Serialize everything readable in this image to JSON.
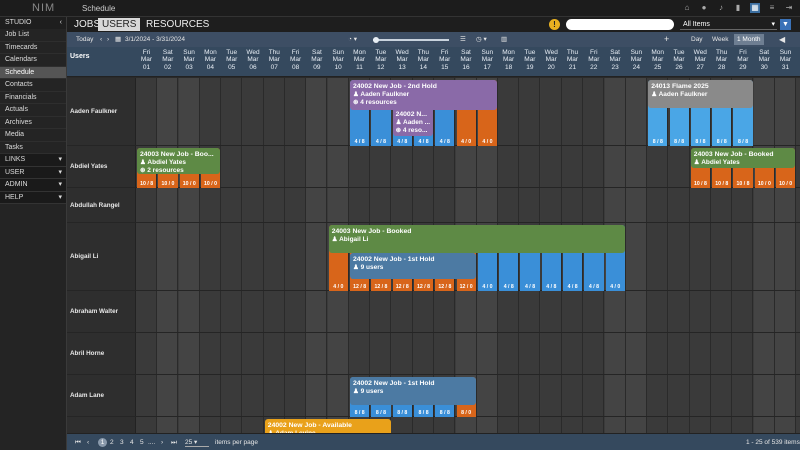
{
  "app": {
    "logo": "NIM",
    "title": "Schedule"
  },
  "top_icons": [
    "home-icon",
    "user-icon",
    "bell-icon",
    "bookmark-icon",
    "apps-icon",
    "sliders-icon",
    "logout-icon"
  ],
  "sidebar": {
    "header": "STUDIO",
    "items": [
      "Job List",
      "Timecards",
      "Calendars",
      "Schedule",
      "Contacts",
      "Financials",
      "Actuals",
      "Archives",
      "Media",
      "Tasks"
    ],
    "active": "Schedule",
    "groups": [
      "LINKS",
      "USER",
      "ADMIN",
      "HELP"
    ]
  },
  "tabs": [
    "JOBS",
    "USERS",
    "RESOURCES"
  ],
  "tabs_selected": "USERS",
  "search": {
    "placeholder": ""
  },
  "filter": {
    "value": "All Items"
  },
  "toolbar": {
    "today": "Today",
    "date_range": "3/1/2024 - 3/31/2024",
    "views": [
      "Day",
      "Week",
      "1 Month"
    ],
    "view_selected": "1 Month",
    "add": "+"
  },
  "columns_header": "Users",
  "days": [
    {
      "dow": "Fri",
      "mon": "Mar",
      "d": "01",
      "we": false
    },
    {
      "dow": "Sat",
      "mon": "Mar",
      "d": "02",
      "we": true
    },
    {
      "dow": "Sun",
      "mon": "Mar",
      "d": "03",
      "we": true
    },
    {
      "dow": "Mon",
      "mon": "Mar",
      "d": "04",
      "we": false
    },
    {
      "dow": "Tue",
      "mon": "Mar",
      "d": "05",
      "we": false
    },
    {
      "dow": "Wed",
      "mon": "Mar",
      "d": "06",
      "we": false
    },
    {
      "dow": "Thu",
      "mon": "Mar",
      "d": "07",
      "we": false
    },
    {
      "dow": "Fri",
      "mon": "Mar",
      "d": "08",
      "we": false
    },
    {
      "dow": "Sat",
      "mon": "Mar",
      "d": "09",
      "we": true
    },
    {
      "dow": "Sun",
      "mon": "Mar",
      "d": "10",
      "we": true
    },
    {
      "dow": "Mon",
      "mon": "Mar",
      "d": "11",
      "we": false
    },
    {
      "dow": "Tue",
      "mon": "Mar",
      "d": "12",
      "we": false
    },
    {
      "dow": "Wed",
      "mon": "Mar",
      "d": "13",
      "we": false
    },
    {
      "dow": "Thu",
      "mon": "Mar",
      "d": "14",
      "we": false
    },
    {
      "dow": "Fri",
      "mon": "Mar",
      "d": "15",
      "we": false
    },
    {
      "dow": "Sat",
      "mon": "Mar",
      "d": "16",
      "we": true
    },
    {
      "dow": "Sun",
      "mon": "Mar",
      "d": "17",
      "we": true
    },
    {
      "dow": "Mon",
      "mon": "Mar",
      "d": "18",
      "we": false
    },
    {
      "dow": "Tue",
      "mon": "Mar",
      "d": "19",
      "we": false
    },
    {
      "dow": "Wed",
      "mon": "Mar",
      "d": "20",
      "we": false
    },
    {
      "dow": "Thu",
      "mon": "Mar",
      "d": "21",
      "we": false
    },
    {
      "dow": "Fri",
      "mon": "Mar",
      "d": "22",
      "we": false
    },
    {
      "dow": "Sat",
      "mon": "Mar",
      "d": "23",
      "we": true
    },
    {
      "dow": "Sun",
      "mon": "Mar",
      "d": "24",
      "we": true
    },
    {
      "dow": "Mon",
      "mon": "Mar",
      "d": "25",
      "we": false
    },
    {
      "dow": "Tue",
      "mon": "Mar",
      "d": "26",
      "we": false
    },
    {
      "dow": "Wed",
      "mon": "Mar",
      "d": "27",
      "we": false
    },
    {
      "dow": "Thu",
      "mon": "Mar",
      "d": "28",
      "we": false
    },
    {
      "dow": "Fri",
      "mon": "Mar",
      "d": "29",
      "we": false
    },
    {
      "dow": "Sat",
      "mon": "Mar",
      "d": "30",
      "we": true
    },
    {
      "dow": "Sun",
      "mon": "Mar",
      "d": "31",
      "we": true
    }
  ],
  "colors": {
    "blue": "#3a8fd8",
    "lightblue": "#4aa6e6",
    "purple": "#8a6aa8",
    "green": "#5e8a45",
    "orange": "#d8651a",
    "amber": "#e9a11a",
    "gray": "#8a8a8a",
    "slate": "#4c7aa3"
  },
  "users": [
    {
      "name": "Aaden Faulkner",
      "bars": [
        {
          "from": 11,
          "to": 15,
          "color": "blue",
          "label": "4 / 8"
        },
        {
          "from": 16,
          "to": 17,
          "color": "orange",
          "label": "4 / 0"
        },
        {
          "from": 25,
          "to": 29,
          "color": "lightblue",
          "label": "8 / 8"
        }
      ],
      "jobs": [
        {
          "from": 11,
          "to": 17,
          "title": "24002 New Job - 2nd Hold",
          "line1": "Aaden Faulkner",
          "line2": "4 resources",
          "color": "purple",
          "y": 2,
          "h": 30
        },
        {
          "from": 13,
          "to": 14,
          "title": "24002 N...",
          "line1": "Aaden ...",
          "line2": "4 reso...",
          "color": "purple",
          "y": 30,
          "h": 28
        },
        {
          "from": 25,
          "to": 29,
          "title": "24013 Flame 2025",
          "line1": "Aaden Faulkner",
          "line2": "",
          "color": "gray",
          "y": 2,
          "h": 28
        }
      ]
    },
    {
      "name": "Abdiel Yates",
      "bars": [
        {
          "from": 1,
          "to": 1,
          "color": "orange",
          "label": "10 / 8"
        },
        {
          "from": 2,
          "to": 4,
          "color": "orange",
          "label": "10 / 0"
        },
        {
          "from": 27,
          "to": 29,
          "color": "orange",
          "label": "10 / 8"
        },
        {
          "from": 30,
          "to": 31,
          "color": "orange",
          "label": "10 / 0"
        }
      ],
      "jobs": [
        {
          "from": 1,
          "to": 4,
          "title": "24003 New Job - Boo...",
          "line1": "Abdiel Yates",
          "line2": "2 resources",
          "color": "green",
          "y": 2,
          "h": 26
        },
        {
          "from": 27,
          "to": 31,
          "title": "24003 New Job - Booked",
          "line1": "Abdiel Yates",
          "line2": "",
          "color": "green",
          "y": 2,
          "h": 20
        }
      ]
    },
    {
      "name": "Abdullah Rangel",
      "bars": [],
      "jobs": []
    },
    {
      "name": "Abigail Li",
      "bars": [
        {
          "from": 10,
          "to": 10,
          "color": "orange",
          "label": "4 / 0"
        },
        {
          "from": 11,
          "to": 15,
          "color": "orange",
          "label": "12 / 8"
        },
        {
          "from": 16,
          "to": 16,
          "color": "orange",
          "label": "12 / 0"
        },
        {
          "from": 17,
          "to": 17,
          "color": "blue",
          "label": "4 / 0"
        },
        {
          "from": 18,
          "to": 22,
          "color": "blue",
          "label": "4 / 8"
        },
        {
          "from": 23,
          "to": 23,
          "color": "blue",
          "label": "4 / 0"
        }
      ],
      "jobs": [
        {
          "from": 10,
          "to": 23,
          "title": "24003 New Job - Booked",
          "line1": "Abigail Li",
          "line2": "",
          "color": "green",
          "y": 2,
          "h": 28
        },
        {
          "from": 11,
          "to": 16,
          "title": "24002 New Job - 1st Hold",
          "line1": "9 users",
          "line2": "",
          "color": "slate",
          "y": 30,
          "h": 26
        }
      ]
    },
    {
      "name": "Abraham Walter",
      "bars": [],
      "jobs": []
    },
    {
      "name": "Abril Horne",
      "bars": [],
      "jobs": []
    },
    {
      "name": "Adam Lane",
      "bars": [
        {
          "from": 11,
          "to": 15,
          "color": "blue",
          "label": "8 / 8"
        },
        {
          "from": 16,
          "to": 16,
          "color": "orange",
          "label": "8 / 0"
        }
      ],
      "jobs": [
        {
          "from": 11,
          "to": 16,
          "title": "24002 New Job - 1st Hold",
          "line1": "9 users",
          "line2": "",
          "color": "slate",
          "y": 2,
          "h": 28
        }
      ]
    },
    {
      "name": "",
      "bars": [],
      "jobs": [
        {
          "from": 7,
          "to": 12,
          "title": "24002 New Job - Available",
          "line1": "Adam Levine",
          "line2": "",
          "color": "amber",
          "y": 2,
          "h": 28
        }
      ]
    }
  ],
  "footer": {
    "pages": [
      "1",
      "2",
      "3",
      "4",
      "5",
      "...."
    ],
    "page_selected": "1",
    "per_page": "25",
    "per_page_label": "items per page",
    "summary": "1 - 25 of 539 items"
  }
}
